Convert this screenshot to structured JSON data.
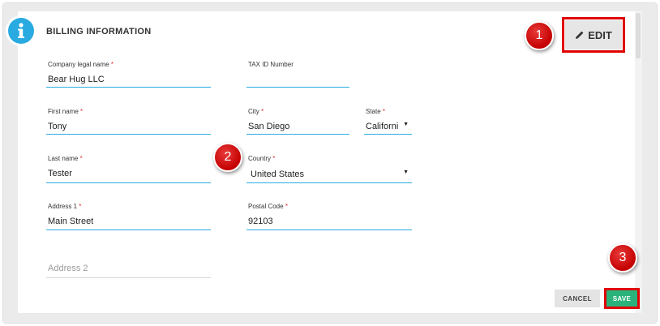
{
  "section": {
    "title": "BILLING INFORMATION"
  },
  "edit_button": {
    "label": "EDIT"
  },
  "fields": {
    "company_legal_name": {
      "label": "Company legal name",
      "required": "*",
      "value": "Bear Hug LLC"
    },
    "tax_id": {
      "label": "TAX ID Number",
      "value": ""
    },
    "first_name": {
      "label": "First name",
      "required": "*",
      "value": "Tony"
    },
    "city": {
      "label": "City",
      "required": "*",
      "value": "San Diego"
    },
    "state": {
      "label": "State",
      "required": "*",
      "value": "Californi"
    },
    "last_name": {
      "label": "Last name",
      "required": "*",
      "value": "Tester"
    },
    "country": {
      "label": "Country",
      "required": "*",
      "value": "United States"
    },
    "address1": {
      "label": "Address 1",
      "required": "*",
      "value": "Main Street"
    },
    "postal_code": {
      "label": "Postal Code",
      "required": "*",
      "value": "92103"
    },
    "address2": {
      "placeholder": "Address 2"
    }
  },
  "actions": {
    "cancel_label": "CANCEL",
    "save_label": "SAVE"
  },
  "callouts": [
    "1",
    "2",
    "3"
  ],
  "colors": {
    "accent": "#29abe2",
    "required": "#e03030",
    "save": "#2ab27b",
    "highlight": "#e00000"
  },
  "icons": {
    "info": "info-icon",
    "edit": "pencil-icon",
    "dropdown": "caret-down-icon"
  }
}
